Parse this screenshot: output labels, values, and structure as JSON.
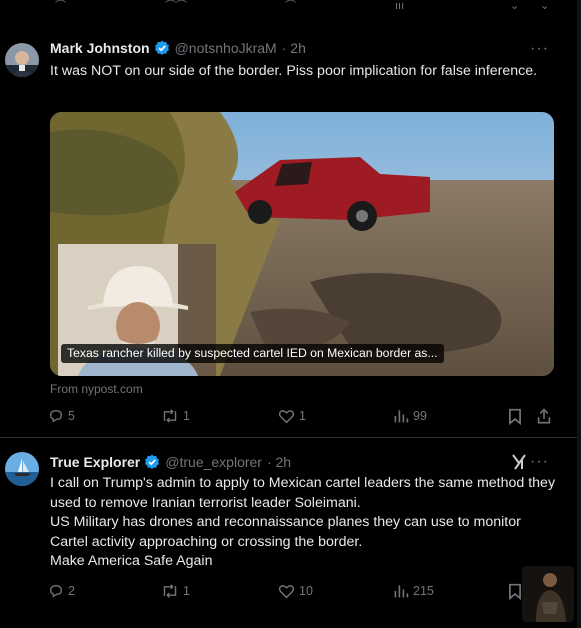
{
  "post1": {
    "name": "Mark Johnston",
    "handle": "@notsnhoJkraM",
    "time": "· 2h",
    "more": "···",
    "text": "It was NOT on our side of the border.  Piss poor implication for false inference.",
    "card_caption": "Texas rancher killed by suspected cartel IED on Mexican border as...",
    "card_source": "From nypost.com",
    "replies": "5",
    "reposts": "1",
    "likes": "1",
    "views": "99"
  },
  "post2": {
    "name": "True Explorer",
    "handle": "@true_explorer",
    "time": "· 2h",
    "more": "···",
    "text_lines": [
      "I call on Trump's admin to apply to Mexican cartel leaders the same method they used to remove Iranian terrorist leader Soleimani.",
      "US Military has drones and reconnaissance planes they can use to monitor Cartel activity approaching or crossing the border.",
      "Make America Safe Again"
    ],
    "replies": "2",
    "reposts": "1",
    "likes": "10",
    "views": "215"
  },
  "colors": {
    "background": "#000000",
    "text": "#e7e9ea",
    "muted": "#71767b",
    "verified": "#1d9bf0"
  }
}
